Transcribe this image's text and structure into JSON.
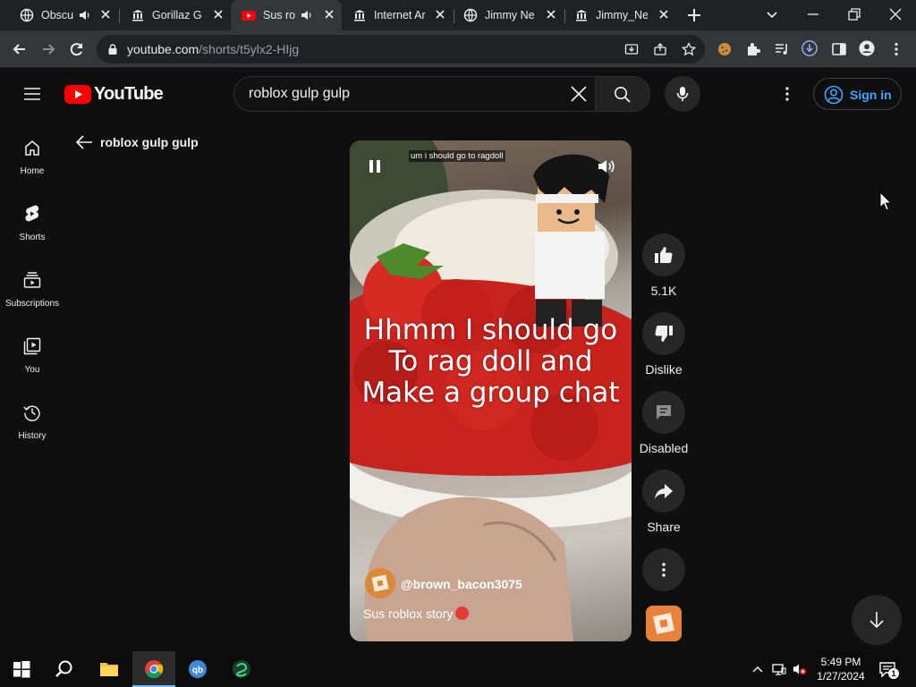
{
  "browser": {
    "tabs": [
      {
        "title": "Obscu",
        "icon": "globe-icon",
        "audio": true
      },
      {
        "title": "Gorillaz Go",
        "icon": "archive-icon",
        "audio": false
      },
      {
        "title": "Sus ro",
        "icon": "youtube-icon",
        "audio": true,
        "active": true
      },
      {
        "title": "Internet Ar",
        "icon": "archive-icon",
        "audio": false
      },
      {
        "title": "Jimmy Ne",
        "icon": "globe-icon",
        "audio": false
      },
      {
        "title": "Jimmy_Ne",
        "icon": "archive-icon",
        "audio": false
      }
    ],
    "url_host": "youtube.com",
    "url_path": "/shorts/t5ylx2-HIjg"
  },
  "youtube": {
    "logo_text": "YouTube",
    "search": {
      "value": "roblox gulp gulp",
      "placeholder": "Search"
    },
    "signin_label": "Sign in",
    "nav": [
      {
        "label": "Home",
        "icon": "home-icon"
      },
      {
        "label": "Shorts",
        "icon": "shorts-icon"
      },
      {
        "label": "Subscriptions",
        "icon": "subscriptions-icon"
      },
      {
        "label": "You",
        "icon": "library-icon"
      },
      {
        "label": "History",
        "icon": "history-icon"
      }
    ],
    "back_label": "roblox gulp gulp"
  },
  "short": {
    "top_caption": "um i should go to ragdoll",
    "overlay_text": [
      "Hhmm I should go",
      "To rag doll and",
      "Make a group chat"
    ],
    "channel_handle": "@brown_bacon3075",
    "description": "Sus roblox story",
    "actions": {
      "like_count": "5.1K",
      "dislike_label": "Dislike",
      "comments_label": "Disabled",
      "share_label": "Share"
    }
  },
  "taskbar": {
    "time": "5:49 PM",
    "date": "1/27/2024",
    "notification_count": "1"
  },
  "colors": {
    "page_bg": "#0f0f0f",
    "youtube_red": "#ff0000",
    "link_blue": "#3ea6ff",
    "chip_bg": "#272727"
  }
}
